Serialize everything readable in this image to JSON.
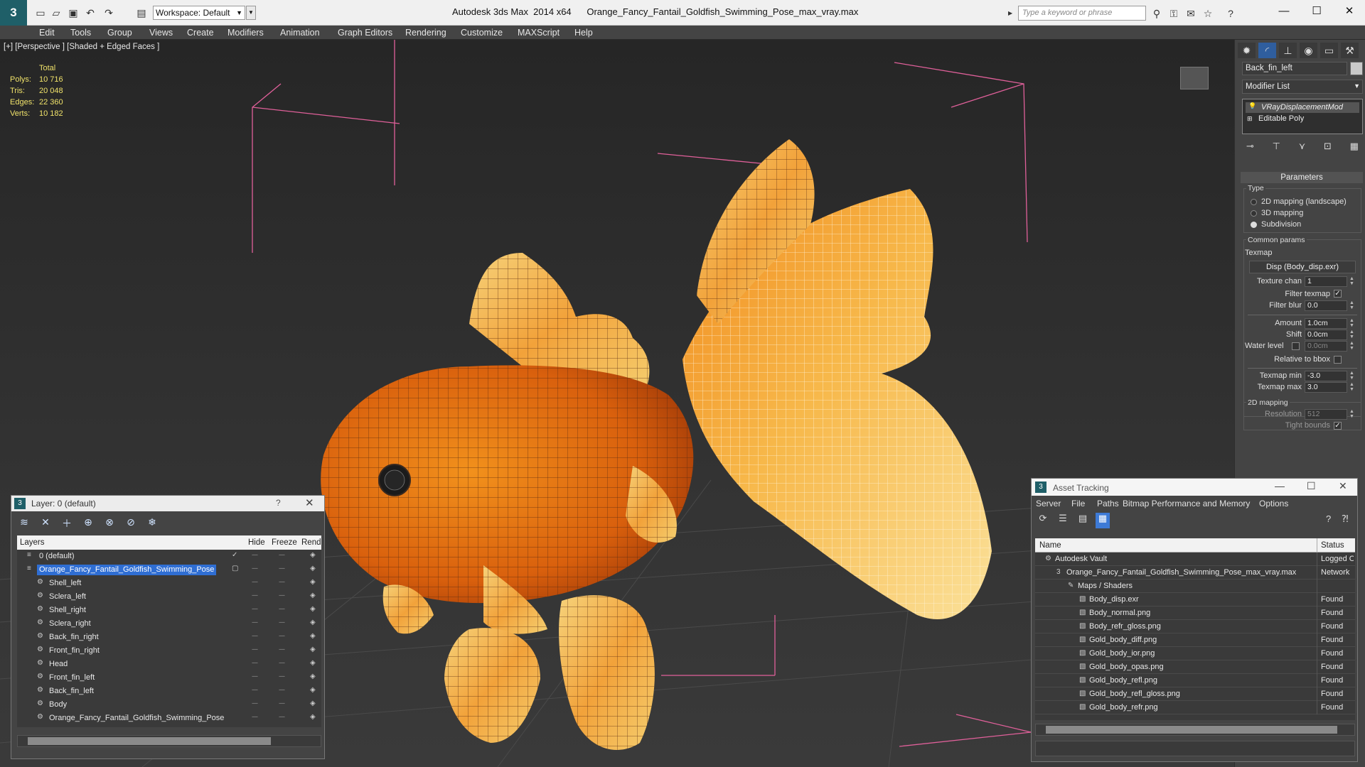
{
  "app": {
    "name": "Autodesk 3ds Max  2014 x64",
    "file": "Orange_Fancy_Fantail_Goldfish_Swimming_Pose_max_vray.max",
    "workspace": "Workspace: Default",
    "search_placeholder": "Type a keyword or phrase"
  },
  "menu": [
    "Edit",
    "Tools",
    "Group",
    "Views",
    "Create",
    "Modifiers",
    "Animation",
    "Graph Editors",
    "Rendering",
    "Customize",
    "MAXScript",
    "Help"
  ],
  "viewport": {
    "label": "[+] [Perspective ] [Shaded + Edged Faces ]",
    "stats": {
      "header": "Total",
      "rows": [
        {
          "label": "Polys:",
          "value": "10 716"
        },
        {
          "label": "Tris:",
          "value": "20 048"
        },
        {
          "label": "Edges:",
          "value": "22 360"
        },
        {
          "label": "Verts:",
          "value": "10 182"
        }
      ]
    }
  },
  "command_panel": {
    "object_name": "Back_fin_left",
    "modifier_list": "Modifier List",
    "stack": [
      "VRayDisplacementMod",
      "Editable Poly"
    ],
    "rollout": "Parameters",
    "type_group": "Type",
    "types": [
      {
        "label": "2D mapping (landscape)",
        "selected": false
      },
      {
        "label": "3D mapping",
        "selected": false
      },
      {
        "label": "Subdivision",
        "selected": true
      }
    ],
    "common_group": "Common params",
    "texmap_label": "Texmap",
    "texmap_button": "Disp (Body_disp.exr)",
    "texture_chan_label": "Texture chan",
    "texture_chan": "1",
    "filter_texmap_label": "Filter texmap",
    "filter_blur_label": "Filter blur",
    "filter_blur": "0.0",
    "amount_label": "Amount",
    "amount": "1.0cm",
    "shift_label": "Shift",
    "shift": "0.0cm",
    "water_level_label": "Water level",
    "water_level": "0.0cm",
    "relative_bbox_label": "Relative to bbox",
    "texmap_min_label": "Texmap min",
    "texmap_min": "-3.0",
    "texmap_max_label": "Texmap max",
    "texmap_max": "3.0",
    "mapping2d_group": "2D mapping",
    "resolution_label": "Resolution",
    "resolution": "512",
    "tight_bounds_label": "Tight bounds"
  },
  "layer_window": {
    "title": "Layer: 0 (default)",
    "help": "?",
    "columns": [
      "Layers",
      "Hide",
      "Freeze",
      "Rend"
    ],
    "rows": [
      {
        "name": "0 (default)",
        "indent": 1,
        "type": "layer"
      },
      {
        "name": "Orange_Fancy_Fantail_Goldfish_Swimming_Pose",
        "indent": 1,
        "type": "layer",
        "selected": true
      },
      {
        "name": "Shell_left",
        "indent": 2,
        "type": "object"
      },
      {
        "name": "Sclera_left",
        "indent": 2,
        "type": "object"
      },
      {
        "name": "Shell_right",
        "indent": 2,
        "type": "object"
      },
      {
        "name": "Sclera_right",
        "indent": 2,
        "type": "object"
      },
      {
        "name": "Back_fin_right",
        "indent": 2,
        "type": "object"
      },
      {
        "name": "Front_fin_right",
        "indent": 2,
        "type": "object"
      },
      {
        "name": "Head",
        "indent": 2,
        "type": "object"
      },
      {
        "name": "Front_fin_left",
        "indent": 2,
        "type": "object"
      },
      {
        "name": "Back_fin_left",
        "indent": 2,
        "type": "object"
      },
      {
        "name": "Body",
        "indent": 2,
        "type": "object"
      },
      {
        "name": "Orange_Fancy_Fantail_Goldfish_Swimming_Pose",
        "indent": 2,
        "type": "object"
      }
    ]
  },
  "asset_tracking": {
    "title": "Asset Tracking",
    "menu": [
      "Server",
      "File",
      "Paths",
      "Bitmap Performance and Memory",
      "Options"
    ],
    "columns": [
      "Name",
      "Status"
    ],
    "rows": [
      {
        "name": "Autodesk Vault",
        "status": "Logged Out",
        "indent": 1
      },
      {
        "name": "Orange_Fancy_Fantail_Goldfish_Swimming_Pose_max_vray.max",
        "status": "Network",
        "indent": 2
      },
      {
        "name": "Maps / Shaders",
        "status": "",
        "indent": 3
      },
      {
        "name": "Body_disp.exr",
        "status": "Found",
        "indent": 4
      },
      {
        "name": "Body_normal.png",
        "status": "Found",
        "indent": 4
      },
      {
        "name": "Body_refr_gloss.png",
        "status": "Found",
        "indent": 4
      },
      {
        "name": "Gold_body_diff.png",
        "status": "Found",
        "indent": 4
      },
      {
        "name": "Gold_body_ior.png",
        "status": "Found",
        "indent": 4
      },
      {
        "name": "Gold_body_opas.png",
        "status": "Found",
        "indent": 4
      },
      {
        "name": "Gold_body_refl.png",
        "status": "Found",
        "indent": 4
      },
      {
        "name": "Gold_body_refl_gloss.png",
        "status": "Found",
        "indent": 4
      },
      {
        "name": "Gold_body_refr.png",
        "status": "Found",
        "indent": 4
      }
    ]
  }
}
